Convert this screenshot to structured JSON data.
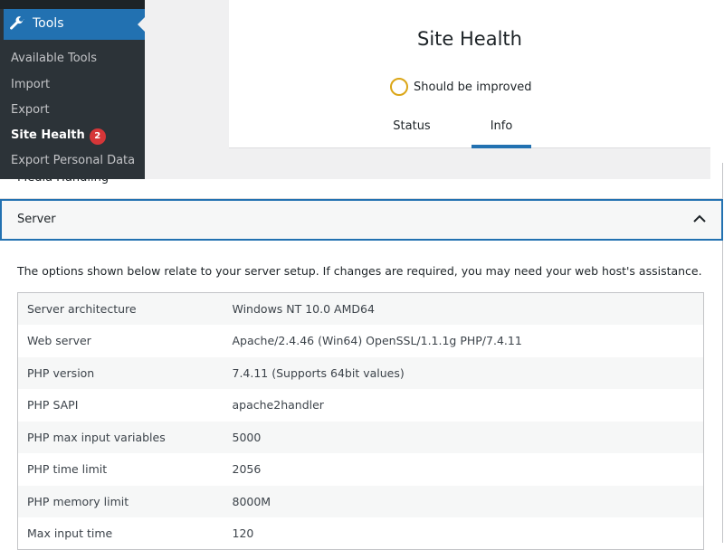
{
  "sidebar": {
    "menu": "Tools",
    "items": [
      {
        "label": "Available Tools"
      },
      {
        "label": "Import"
      },
      {
        "label": "Export"
      },
      {
        "label": "Site Health",
        "badge": "2"
      },
      {
        "label": "Export Personal Data"
      }
    ]
  },
  "header": {
    "title": "Site Health",
    "status": "Should be improved",
    "status_color": "#dba617",
    "tabs": [
      {
        "label": "Status"
      },
      {
        "label": "Info"
      }
    ],
    "active_tab": "Info"
  },
  "sections": {
    "media": "Media Handling",
    "server": "Server"
  },
  "server": {
    "description": "The options shown below relate to your server setup. If changes are required, you may need your web host's assistance.",
    "rows": [
      [
        "Server architecture",
        "Windows NT 10.0 AMD64"
      ],
      [
        "Web server",
        "Apache/2.4.46 (Win64) OpenSSL/1.1.1g PHP/7.4.11"
      ],
      [
        "PHP version",
        "7.4.11 (Supports 64bit values)"
      ],
      [
        "PHP SAPI",
        "apache2handler"
      ],
      [
        "PHP max input variables",
        "5000"
      ],
      [
        "PHP time limit",
        "2056"
      ],
      [
        "PHP memory limit",
        "8000M"
      ],
      [
        "Max input time",
        "120"
      ]
    ]
  },
  "colors": {
    "accent": "#2271b1",
    "sidebar": "#2c3338",
    "badge": "#d63638"
  }
}
